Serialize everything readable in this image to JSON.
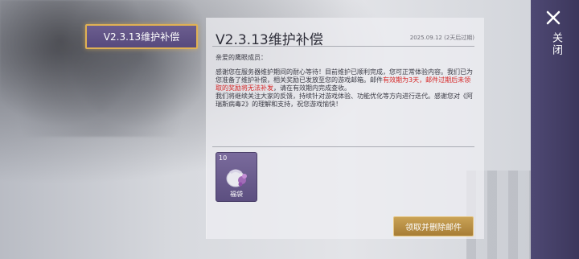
{
  "tabs": [
    {
      "label": "V2.3.13维护补偿",
      "active": true
    }
  ],
  "mail": {
    "title": "V2.3.13维护补偿",
    "date": "2025.09.12 (2天后过期)",
    "greeting": "亲爱的鹰眼成员：",
    "body": {
      "p1": "感谢您在服务器维护期间的耐心等待！目前维护已顺利完成，您可正常体验内容。我们已为您准备了维护补偿，相关奖励已发放至您的游戏邮箱。邮件",
      "p1_red1": "有效期为3天，邮件过期后未领取的奖励将无法补发",
      "p1_end": "，请在有效期内完成查收。",
      "p2": "我们将继续关注大家的反馈，持续针对游戏体验、功能优化等方向进行迭代。感谢您对《阿瑞斯病毒2》的理解和支持，祝您游戏愉快！"
    }
  },
  "attachment": {
    "count": "10",
    "name": "福袋",
    "icon": "gift-bag-icon"
  },
  "actions": {
    "claim_delete": "领取并删除邮件",
    "close": "关闭"
  },
  "colors": {
    "accent_gold": "#e0b154",
    "tab_purple": "#574a7d",
    "sidebar": "#3c375c",
    "warning_red": "#d62525"
  }
}
